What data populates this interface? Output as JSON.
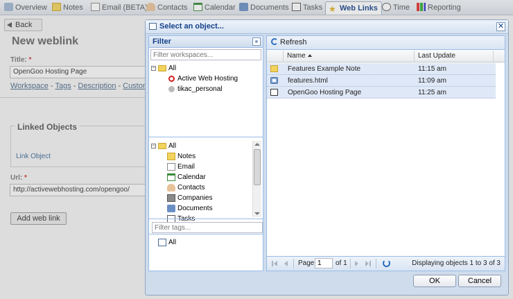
{
  "tabs": [
    {
      "label": "Overview"
    },
    {
      "label": "Notes"
    },
    {
      "label": "Email (BETA)"
    },
    {
      "label": "Contacts"
    },
    {
      "label": "Calendar"
    },
    {
      "label": "Documents"
    },
    {
      "label": "Tasks"
    },
    {
      "label": "Web Links",
      "active": true
    },
    {
      "label": "Time"
    },
    {
      "label": "Reporting"
    }
  ],
  "page": {
    "back_label": "Back",
    "title": "New weblink",
    "title_label": "Title:",
    "title_value": "OpenGoo Hosting Page",
    "links": [
      "Workspace",
      "Tags",
      "Description",
      "Custom"
    ],
    "linked_objects_legend": "Linked Objects",
    "link_object_label": "Link Object",
    "url_label": "Url:",
    "url_value": "http://activewebhosting.com/opengoo/",
    "add_button": "Add web link"
  },
  "dialog": {
    "title": "Select an object...",
    "filter": {
      "header": "Filter",
      "workspace_placeholder": "Filter workspaces...",
      "workspaces": [
        "All",
        "Active Web Hosting",
        "tikac_personal"
      ],
      "types": [
        "All",
        "Notes",
        "Email",
        "Calendar",
        "Contacts",
        "Companies",
        "Documents",
        "Tasks"
      ],
      "tags_placeholder": "Filter tags...",
      "tags": [
        "All"
      ]
    },
    "grid": {
      "refresh_label": "Refresh",
      "columns": [
        "Name",
        "Last Update"
      ],
      "rows": [
        {
          "icon": "note-icon",
          "name": "Features Example Note",
          "updated": "11:15 am"
        },
        {
          "icon": "html-file-icon",
          "name": "features.html",
          "updated": "11:09 am"
        },
        {
          "icon": "weblink-icon",
          "name": "OpenGoo Hosting Page",
          "updated": "11:25 am"
        }
      ],
      "pager": {
        "page_label": "Page",
        "page_value": "1",
        "of_label": "of 1",
        "display_msg": "Displaying objects 1 to 3 of 3"
      }
    },
    "ok_label": "OK",
    "cancel_label": "Cancel"
  },
  "colors": {
    "accent": "#15428b",
    "selection": "#dfe8f6",
    "required": "#cc3333"
  }
}
